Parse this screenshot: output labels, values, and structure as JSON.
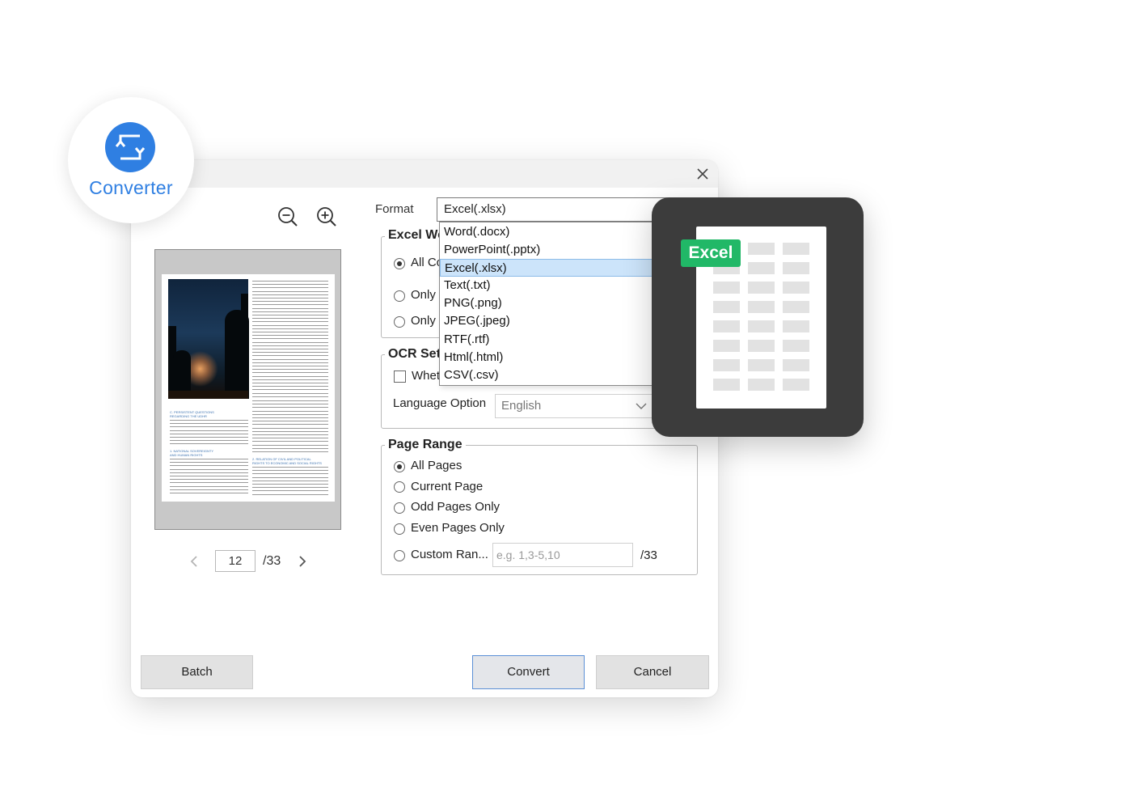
{
  "badge": {
    "label": "Converter",
    "icon": "convert-icon",
    "color": "#2f7fe2"
  },
  "preview": {
    "current_page": "12",
    "total_pages": "/33",
    "document_headings": [
      "C. PERSISTENT QUESTIONS",
      "REGARDING THE UDHR",
      "1. NATIONAL SOVEREIGNTY",
      "AND HUMAN RIGHTS",
      "2. RELATION OF CIVIL AND POLITICAL",
      "RIGHTS TO ECONOMIC AND SOCIAL RIGHTS"
    ]
  },
  "format": {
    "label": "Format",
    "selected": "Excel(.xlsx)",
    "options": [
      "Word(.docx)",
      "PowerPoint(.pptx)",
      "Excel(.xlsx)",
      "Text(.txt)",
      "PNG(.png)",
      "JPEG(.jpeg)",
      "RTF(.rtf)",
      "Html(.html)",
      "CSV(.csv)"
    ],
    "selected_index": 2
  },
  "excel_group": {
    "title": "Excel Wo",
    "options": [
      "All Co",
      "Only",
      "Only"
    ]
  },
  "ocr_group": {
    "title": "OCR Set",
    "checkbox_label": "Whet",
    "language_label": "Language Option",
    "language_value": "English"
  },
  "page_range": {
    "title": "Page Range",
    "options": [
      "All Pages",
      "Current Page",
      "Odd Pages Only",
      "Even Pages Only",
      "Custom Ran..."
    ],
    "custom_placeholder": "e.g. 1,3-5,10",
    "custom_total": "/33"
  },
  "buttons": {
    "batch": "Batch",
    "convert": "Convert",
    "cancel": "Cancel"
  },
  "excel_card": {
    "tag": "Excel",
    "tag_color": "#21b867"
  }
}
